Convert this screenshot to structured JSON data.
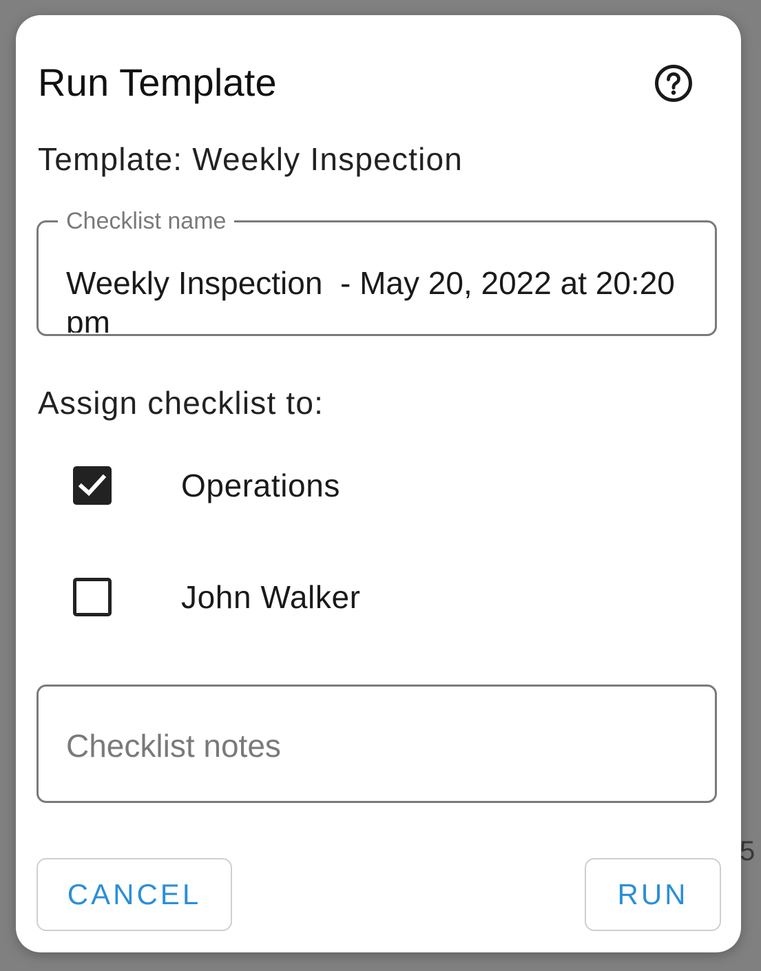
{
  "backdrop": {
    "peek_text": "5"
  },
  "dialog": {
    "title": "Run Template",
    "help_icon": "help-circle-icon",
    "template_line": "Template: Weekly Inspection",
    "checklist_name": {
      "label": "Checklist name",
      "value": "Weekly Inspection  - May 20, 2022 at 20:20 pm"
    },
    "assign_label": "Assign checklist to:",
    "assignees": [
      {
        "label": "Operations",
        "checked": true
      },
      {
        "label": "John Walker",
        "checked": false
      }
    ],
    "notes": {
      "placeholder": "Checklist notes",
      "value": ""
    },
    "actions": {
      "cancel_label": "CANCEL",
      "run_label": "RUN"
    },
    "colors": {
      "accent": "#2b8fd8",
      "backdrop": "#808080",
      "border": "#7a7a7a"
    }
  }
}
